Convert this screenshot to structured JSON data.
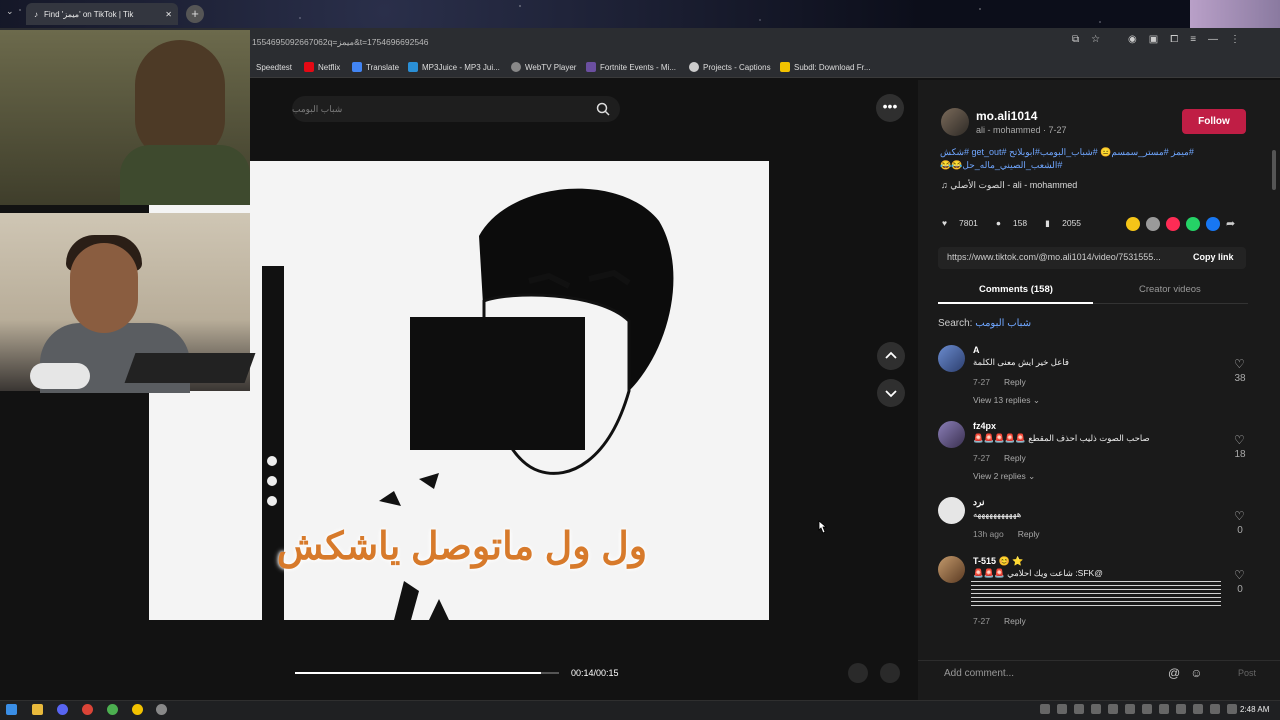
{
  "browser": {
    "tab_title": "Find 'ميمز' on TikTok | Tik",
    "url": "1554695092667062q=ميمز&t=1754696692546",
    "bookmarks": [
      {
        "label": "Speedtest"
      },
      {
        "label": "Netflix"
      },
      {
        "label": "Translate"
      },
      {
        "label": "MP3Juice - MP3 Jui..."
      },
      {
        "label": "WebTV Player"
      },
      {
        "label": "Fortnite Events - Mi..."
      },
      {
        "label": "Projects - Captions"
      },
      {
        "label": "Subdl: Download Fr..."
      }
    ]
  },
  "tiktok": {
    "search_placeholder": "شباب البومب",
    "video_caption": "ول ول ماتوصل ياشكش",
    "time": "00:14/00:15",
    "progress_fraction": 0.93,
    "author": {
      "username": "mo.ali1014",
      "subtitle": "ali - mohammed · 7-27",
      "follow_label": "Follow"
    },
    "description": "#ميمز #مستر_سمسم😑 #شباب_البومب#ابوبلاتح #get_out #شكش #الشعب_الصيني_ماله_حل😂😂",
    "music": "الصوت الأصلي - ali - mohammed",
    "stats": {
      "likes": "7801",
      "comments": "158",
      "saves": "2055"
    },
    "link": "https://www.tiktok.com/@mo.ali1014/video/7531555...",
    "copy_link_label": "Copy link",
    "tabs": {
      "comments": "Comments (158)",
      "creator": "Creator videos"
    },
    "search_line_prefix": "Search:",
    "search_line_query": "شباب البومب",
    "comments": [
      {
        "name": "A",
        "text": "فاعل خير ايش معنى الكلمة",
        "date": "7-27",
        "reply": "Reply",
        "likes": "38",
        "replies": "View 13 replies"
      },
      {
        "name": "fz4px",
        "text": "صاحب الصوت ذليب احذف المقطع 🚨🚨🚨🚨🚨",
        "date": "7-27",
        "reply": "Reply",
        "likes": "18",
        "replies": "View 2 replies"
      },
      {
        "name": "نرد",
        "text": "هههههههههههه",
        "date": "13h ago",
        "reply": "Reply",
        "likes": "0",
        "replies": ""
      },
      {
        "name": "T-515 😊 ⭐",
        "text": "@SFK: شاعت ويك احلامي 🚨🚨🚨",
        "date": "7-27",
        "reply": "Reply",
        "likes": "0",
        "replies": ""
      }
    ],
    "add_comment_placeholder": "Add comment...",
    "post_label": "Post"
  },
  "taskbar": {
    "clock": "2:48 AM"
  }
}
